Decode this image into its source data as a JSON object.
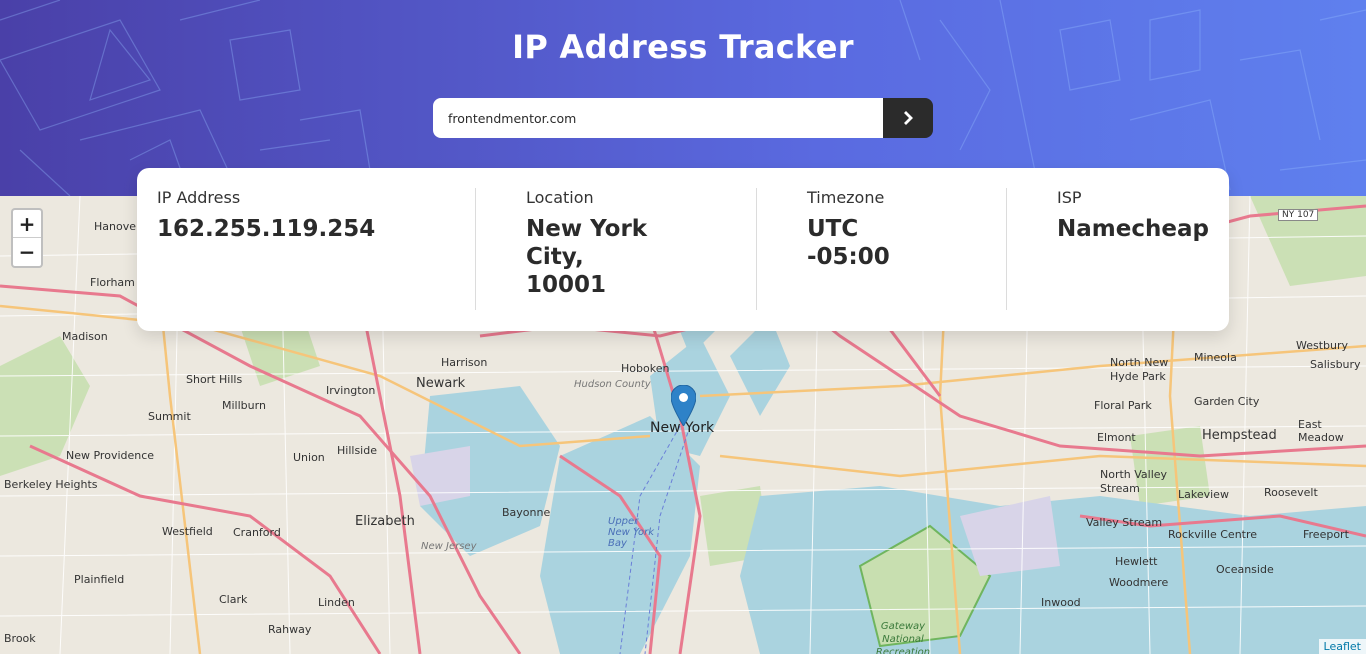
{
  "header": {
    "title": "IP Address Tracker"
  },
  "search": {
    "value": "frontendmentor.com",
    "submit_icon": "chevron-right-icon"
  },
  "info": {
    "ip": {
      "label": "IP Address",
      "value": "162.255.119.254"
    },
    "location": {
      "label": "Location",
      "value_lines": [
        "New York",
        "City,",
        "10001"
      ]
    },
    "timezone": {
      "label": "Timezone",
      "value_lines": [
        "UTC",
        "-05:00"
      ]
    },
    "isp": {
      "label": "ISP",
      "value": "Namecheap"
    }
  },
  "map": {
    "zoom_in": "+",
    "zoom_out": "−",
    "attribution": "Leaflet",
    "marker_icon": "map-pin-icon",
    "place_labels": {
      "new_york": "New York",
      "newark": "Newark",
      "hoboken": "Hoboken",
      "elizabeth": "Elizabeth",
      "bayonne": "Bayonne",
      "hempstead": "Hempstead",
      "irvington": "Irvington",
      "summit": "Summit",
      "millburn": "Millburn",
      "madison": "Madison",
      "florham": "Florham",
      "hanover": "Hanover",
      "short_hills": "Short Hills",
      "new_providence": "New Providence",
      "berkeley_heights": "Berkeley Heights",
      "westfield": "Westfield",
      "cranford": "Cranford",
      "plainfield": "Plainfield",
      "clark": "Clark",
      "linden": "Linden",
      "rahway": "Rahway",
      "union": "Union",
      "hillside": "Hillside",
      "harrison": "Harrison",
      "hudson_county": "Hudson County",
      "upper_new_york_bay": "Upper New York Bay",
      "new_jersey": "New Jersey",
      "mineola": "Mineola",
      "westbury": "Westbury",
      "salisbury": "Salisbury",
      "north_new_hyde_park": "North New Hyde Park",
      "floral_park": "Floral Park",
      "garden_city": "Garden City",
      "elmont": "Elmont",
      "east_meadow": "East Meadow",
      "north_valley_stream": "North Valley Stream",
      "lakeview": "Lakeview",
      "roosevelt": "Roosevelt",
      "valley_stream": "Valley Stream",
      "rockville_centre": "Rockville Centre",
      "freeport": "Freeport",
      "hewlett": "Hewlett",
      "oceanside": "Oceanside",
      "woodmere": "Woodmere",
      "inwood": "Inwood",
      "gateway": "Gateway National Recreation",
      "ny107": "NY 107",
      "brook": "Brook"
    }
  }
}
